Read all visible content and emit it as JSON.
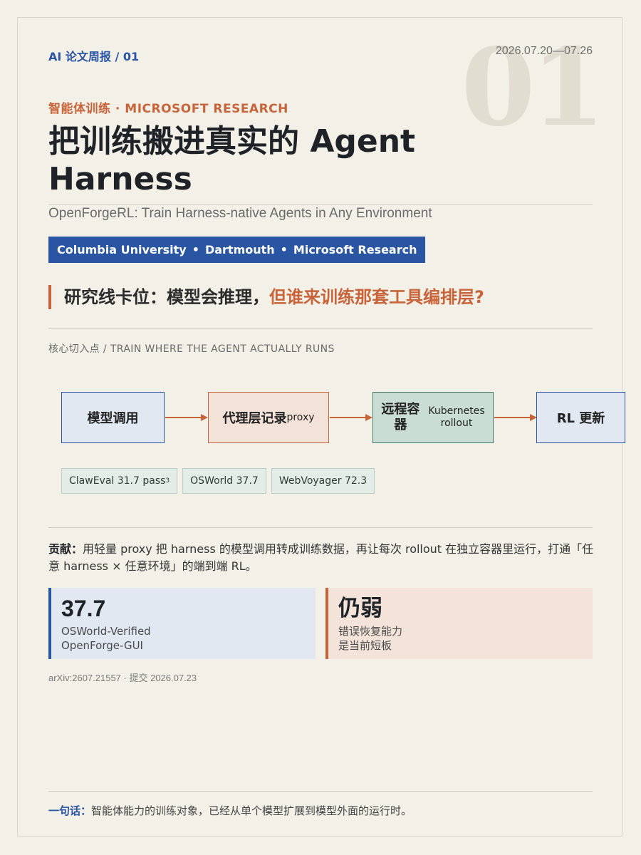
{
  "header": {
    "issue_label": "AI 论文周报 / 01",
    "date_range": "2026.07.20—07.26",
    "issue_number": "01"
  },
  "article": {
    "category": "智能体训练 · MICROSOFT RESEARCH",
    "title": "把训练搬进真实的 Agent Harness",
    "subtitle": "OpenForgeRL: Train Harness-native Agents in Any Environment",
    "affiliations": [
      "Columbia University",
      "Dartmouth",
      "Microsoft Research"
    ],
    "affil_sep": "•",
    "question_prefix": "研究线卡位：模型会推理，",
    "question_highlight": "但谁来训练那套工具编排层?"
  },
  "diagram": {
    "section_label": "核心切入点 / TRAIN WHERE THE AGENT ACTUALLY RUNS",
    "nodes": [
      {
        "label": "模型调用"
      },
      {
        "label": "代理层记录",
        "sub": "proxy"
      },
      {
        "label": "远程容器",
        "sub": "Kubernetes rollout"
      },
      {
        "label": "RL 更新"
      }
    ],
    "node3_line1": "远程容",
    "node3_line2": "器",
    "node3_sub1": "Kubernetes",
    "node3_sub2": "rollout",
    "metrics": [
      {
        "text": "ClawEval 31.7 pass",
        "sup": "3"
      },
      {
        "text": "OSWorld 37.7"
      },
      {
        "text": "WebVoyager 72.3"
      }
    ]
  },
  "contribution": {
    "label": "贡献：",
    "text": "用轻量 proxy 把 harness 的模型调用转成训练数据，再让每次 rollout 在独立容器里运行，打通「任意 harness × 任意环境」的端到端 RL。"
  },
  "cards": [
    {
      "value": "37.7",
      "desc_line1": "OSWorld-Verified",
      "desc_line2": "OpenForge-GUI",
      "accent": "#2a55a3"
    },
    {
      "value": "仍弱",
      "desc_line1": "错误恢复能力",
      "desc_line2": "是当前短板",
      "accent": "#c8643a"
    }
  ],
  "meta": {
    "arxiv": "arXiv:2607.21557 · 提交 2026.07.23"
  },
  "footer": {
    "label": "一句话：",
    "text": "智能体能力的训练对象，已经从单个模型扩展到模型外面的运行时。"
  },
  "colors": {
    "blue": "#2a55a3",
    "orange": "#c8643a",
    "green": "#3e7a66",
    "background": "#f3f0e8"
  }
}
